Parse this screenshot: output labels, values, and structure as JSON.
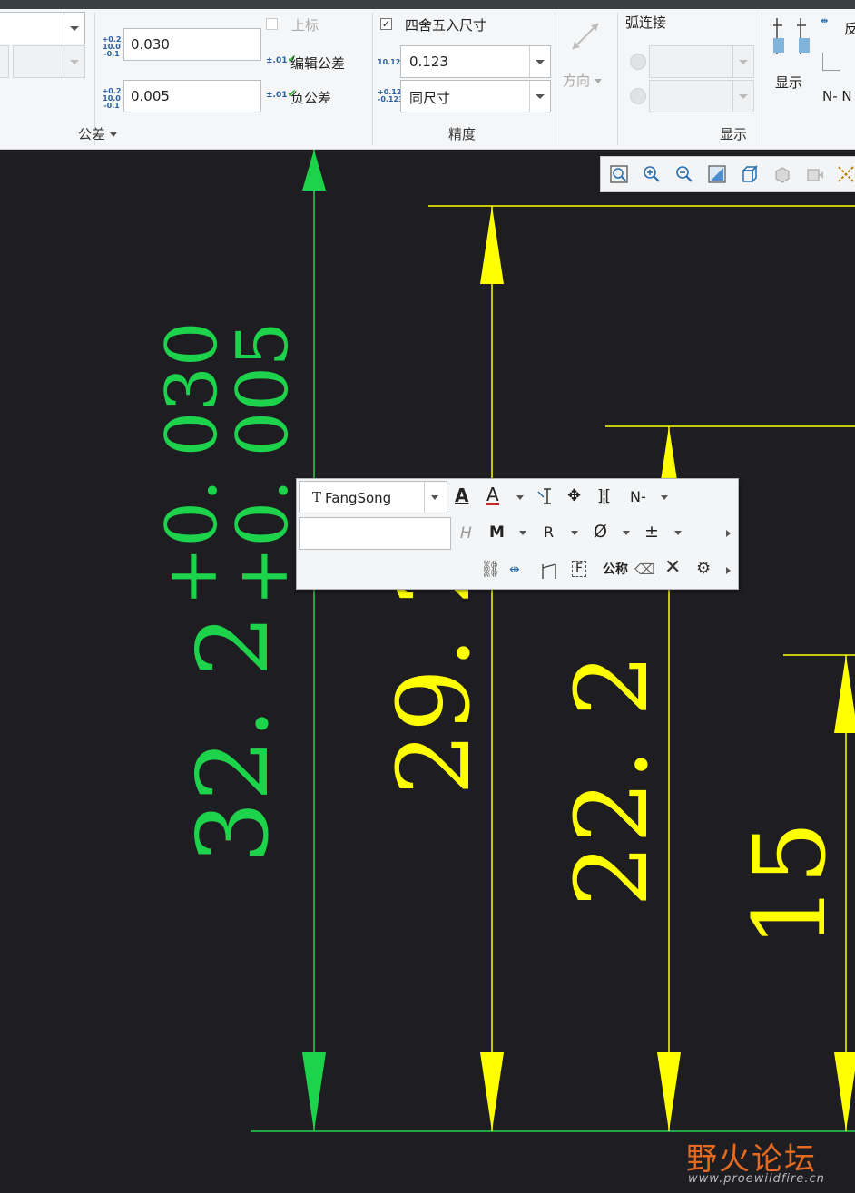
{
  "tolerance_group": {
    "label": "公差",
    "upper_value": "0.030",
    "lower_value": "0.005",
    "upper_tolerance_label": "上标",
    "edit_tolerance_label": "编辑公差",
    "negative_tolerance_label": "负公差",
    "tol_icon_text": "+0.2 10.0 -0.1"
  },
  "precision_group": {
    "label": "精度",
    "round_label": "四舍五入尺寸",
    "round_checked": true,
    "decimal_value": "0.123",
    "tol_decimal_value": "同尺寸",
    "decimal_icon_text": "10.123",
    "tol_decimal_icon_text": "+0.123 -0.123"
  },
  "display_group": {
    "label": "显示",
    "direction_label": "方向",
    "arc_join_label": "弧连接",
    "display_button_label": "显示",
    "flip_label": "反",
    "n_label": "N- N"
  },
  "mini_toolbar": {
    "font_name": "FangSong",
    "font_icon": "T",
    "letter_a": "A",
    "text_input_value": "",
    "italic_h": "H",
    "bold_m": "M",
    "r_label": "R",
    "diameter": "Ø",
    "plus_minus": "±",
    "n_label": "N-",
    "symmetric_label": "公称",
    "f_label": "F"
  },
  "drawing": {
    "colors": {
      "green": "#1ed34c",
      "yellow": "#ffff00",
      "bg": "#1e1e22"
    },
    "dim_main": "32. 2",
    "tol_upper": "+0. 030",
    "tol_lower": "+0. 005",
    "dim_b": "29. 2",
    "dim_c": "22. 2",
    "dim_d": "15"
  },
  "watermark": {
    "text_cn": "野火论坛",
    "url": "www.proewildfire.cn"
  }
}
